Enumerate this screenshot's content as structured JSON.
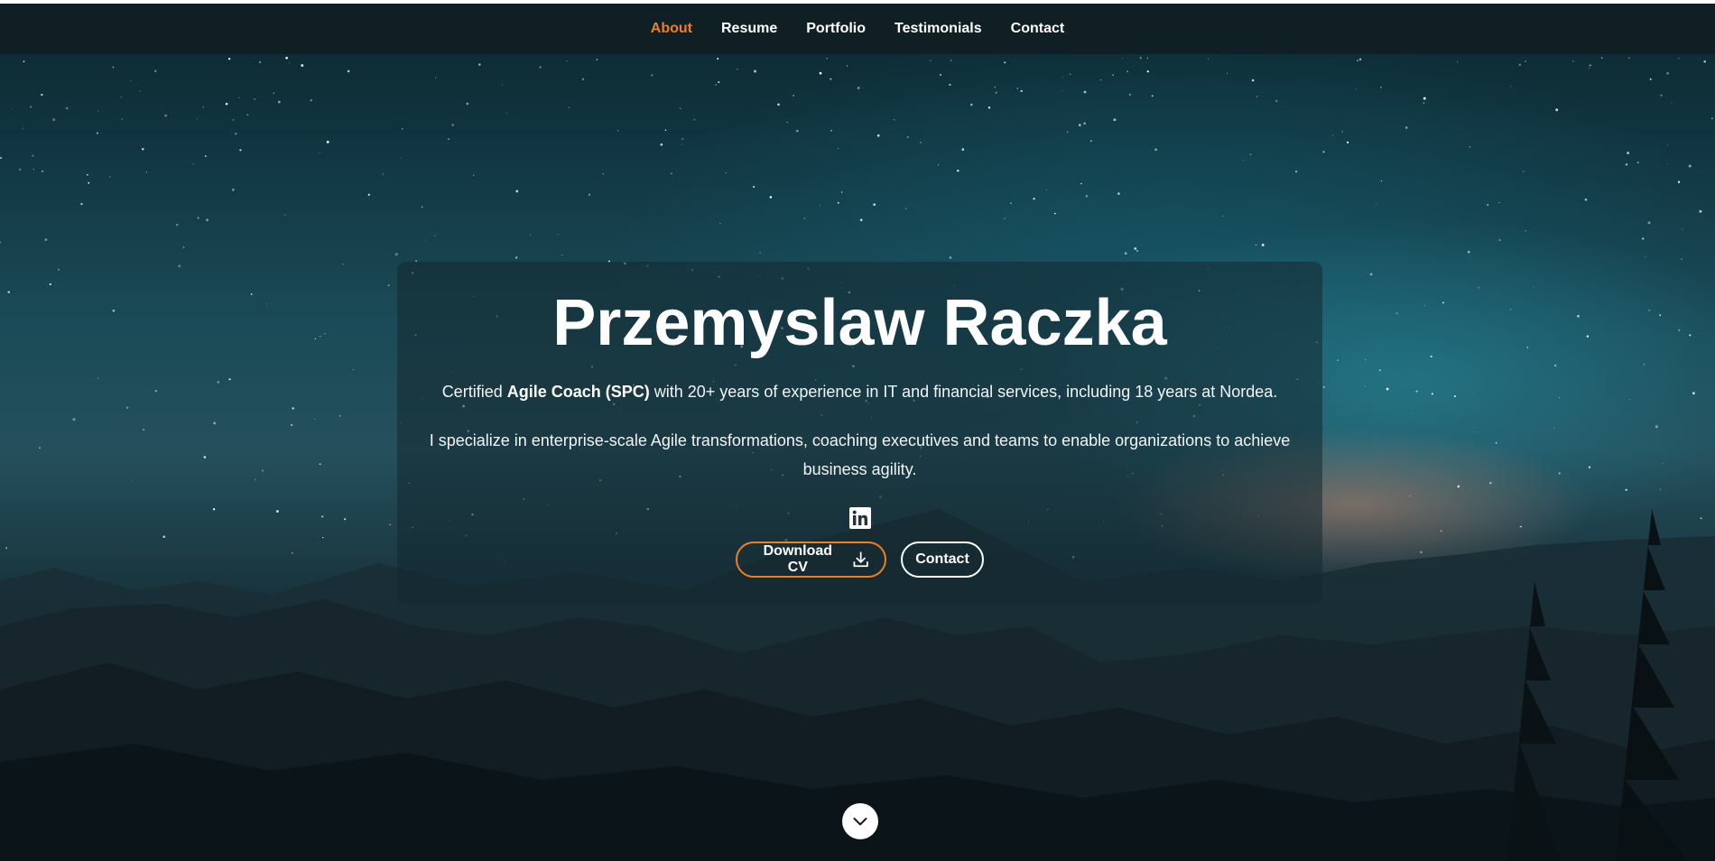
{
  "nav": {
    "items": [
      {
        "label": "About",
        "active": true
      },
      {
        "label": "Resume",
        "active": false
      },
      {
        "label": "Portfolio",
        "active": false
      },
      {
        "label": "Testimonials",
        "active": false
      },
      {
        "label": "Contact",
        "active": false
      }
    ]
  },
  "hero": {
    "name": "Przemyslaw Raczka",
    "intro_prefix": "Certified ",
    "intro_bold": "Agile Coach (SPC)",
    "intro_suffix": " with 20+ years of experience in IT and financial services, including 18 years at Nordea.",
    "description": "I specialize in enterprise-scale Agile transformations, coaching executives and teams to enable organizations to achieve business agility.",
    "social_icon": "linkedin-icon",
    "buttons": {
      "download_cv": "Download CV",
      "contact": "Contact"
    },
    "scroll_icon": "chevron-down-icon"
  },
  "colors": {
    "accent": "#f07f24",
    "navbar": "#101e22",
    "text": "#ffffff"
  }
}
